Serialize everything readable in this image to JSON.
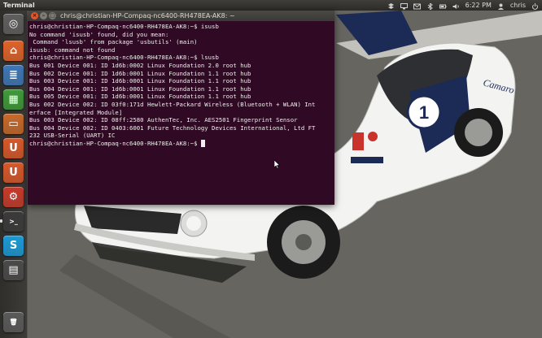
{
  "panel": {
    "app_title": "Terminal",
    "clock": "6:22 PM",
    "user": "chris"
  },
  "window": {
    "title": "chris@christian-HP-Compaq-nc6400-RH478EA-AK8: ~"
  },
  "terminal": {
    "lines": [
      "chris@christian-HP-Compaq-nc6400-RH478EA-AK8:~$ isusb",
      "No command 'isusb' found, did you mean:",
      " Command 'lsusb' from package 'usbutils' (main)",
      "isusb: command not found",
      "chris@christian-HP-Compaq-nc6400-RH478EA-AK8:~$ lsusb",
      "Bus 001 Device 001: ID 1d6b:0002 Linux Foundation 2.0 root hub",
      "Bus 002 Device 001: ID 1d6b:0001 Linux Foundation 1.1 root hub",
      "Bus 003 Device 001: ID 1d6b:0001 Linux Foundation 1.1 root hub",
      "Bus 004 Device 001: ID 1d6b:0001 Linux Foundation 1.1 root hub",
      "Bus 005 Device 001: ID 1d6b:0001 Linux Foundation 1.1 root hub",
      "Bus 002 Device 002: ID 03f0:171d Hewlett-Packard Wireless (Bluetooth + WLAN) Int",
      "erface [Integrated Module]",
      "Bus 003 Device 002: ID 08ff:2580 AuthenTec, Inc. AES2501 Fingerprint Sensor",
      "Bus 004 Device 002: ID 0403:6001 Future Technology Devices International, Ltd FT",
      "232 USB-Serial (UART) IC",
      "chris@christian-HP-Compaq-nc6400-RH478EA-AK8:~$ "
    ]
  },
  "wallpaper": {
    "car_number": "1",
    "car_text": "Camaro"
  },
  "launcher": {
    "items": [
      {
        "name": "dash-home-icon",
        "color": "#5f5f5f"
      },
      {
        "name": "home-folder-icon",
        "color": "#e0632a"
      },
      {
        "name": "writer-icon",
        "color": "#3f77b7"
      },
      {
        "name": "calc-icon",
        "color": "#3f9a3a"
      },
      {
        "name": "impress-icon",
        "color": "#c86a2a"
      },
      {
        "name": "software-center-icon",
        "color": "#d9582a"
      },
      {
        "name": "ubuntu-one-icon",
        "color": "#d9582a"
      },
      {
        "name": "settings-icon",
        "color": "#c83a2a"
      },
      {
        "name": "terminal-icon",
        "color": "#3a3a3a"
      },
      {
        "name": "skype-icon",
        "color": "#1b9ad6"
      },
      {
        "name": "workspaces-icon",
        "color": "#4a4a4a"
      },
      {
        "name": "trash-icon",
        "color": "#5a5a5a"
      }
    ]
  }
}
